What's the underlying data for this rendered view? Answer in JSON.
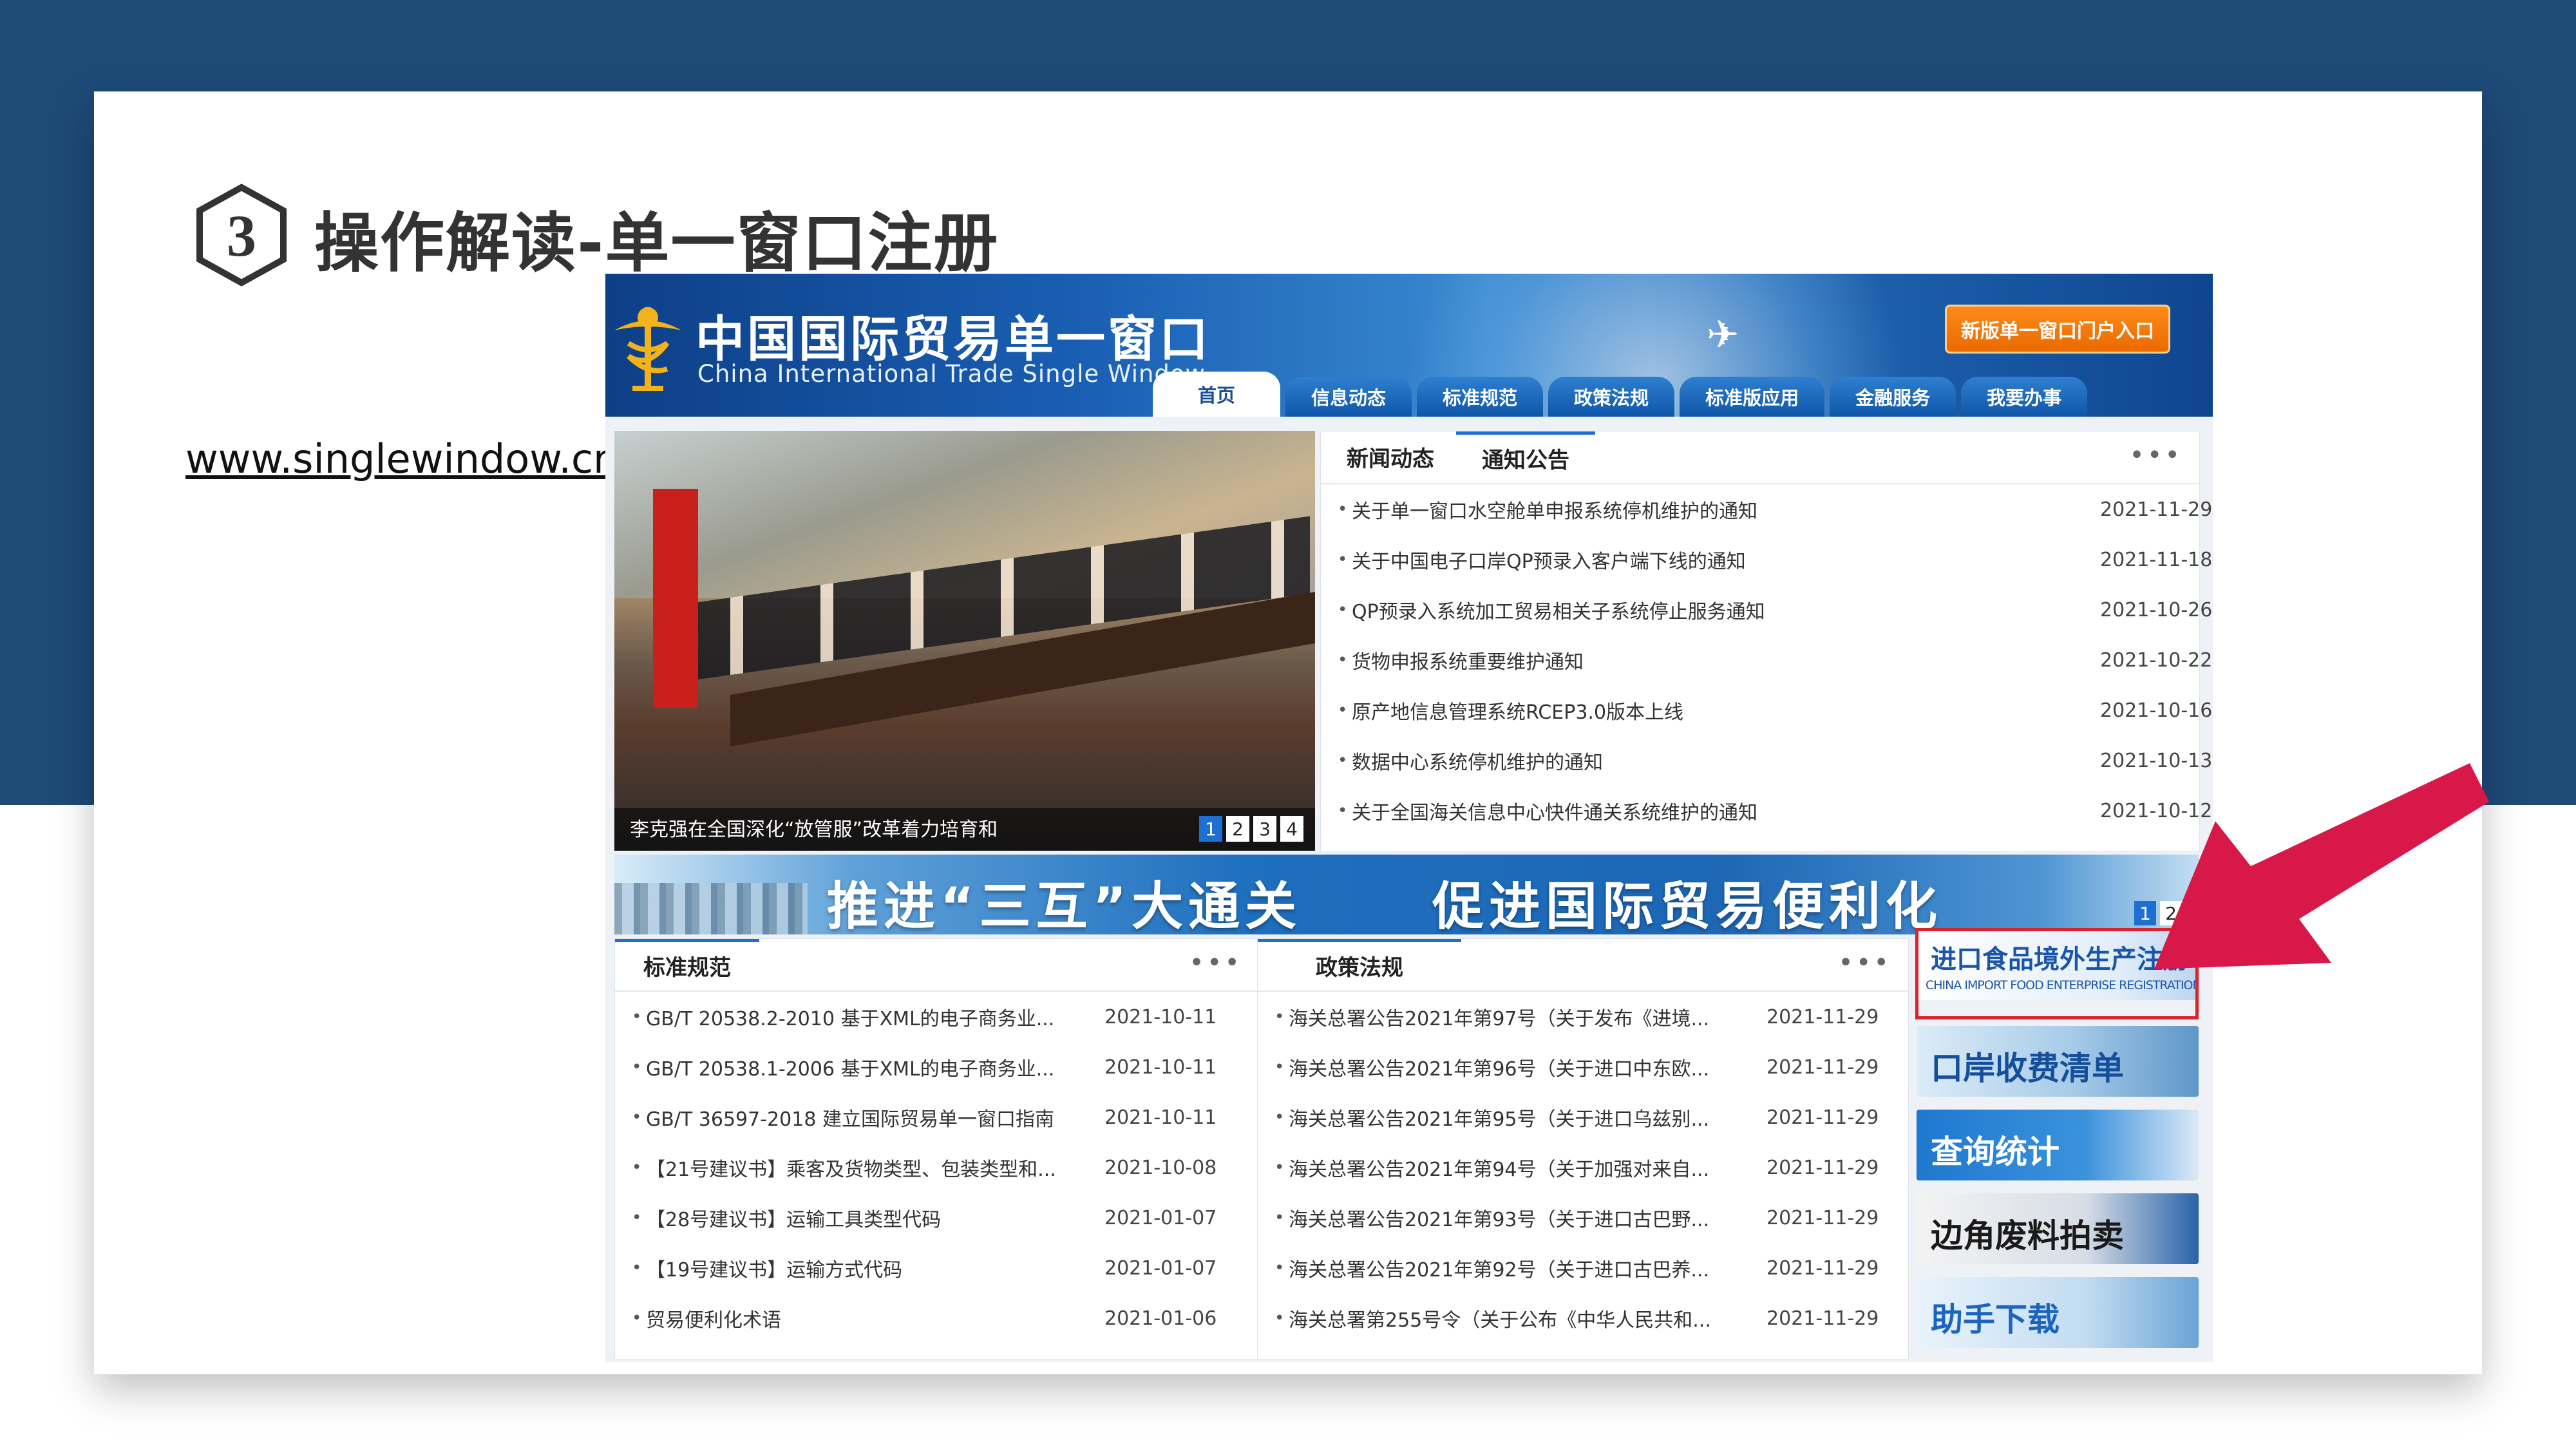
{
  "slide": {
    "number": "3",
    "title": "操作解读-单一窗口注册",
    "url": "www.singlewindow.cn"
  },
  "site": {
    "logo_cn": "中国国际贸易单一窗口",
    "logo_en": "China International Trade Single  Window",
    "portal_button": "新版单一窗口门户入口",
    "nav": [
      "首页",
      "信息动态",
      "标准规范",
      "政策法规",
      "标准版应用",
      "金融服务",
      "我要办事"
    ],
    "active_nav": "首页"
  },
  "carousel": {
    "caption": "李克强在全国深化“放管服”改革着力培育和",
    "pages": [
      "1",
      "2",
      "3",
      "4"
    ],
    "active_page": "1"
  },
  "news": {
    "tabs": [
      "新闻动态",
      "通知公告"
    ],
    "active_tab": "通知公告",
    "more": "•••",
    "items": [
      {
        "title": "关于单一窗口水空舱单申报系统停机维护的通知",
        "date": "2021-11-29"
      },
      {
        "title": "关于中国电子口岸QP预录入客户端下线的通知",
        "date": "2021-11-18"
      },
      {
        "title": "QP预录入系统加工贸易相关子系统停止服务通知",
        "date": "2021-10-26"
      },
      {
        "title": "货物申报系统重要维护通知",
        "date": "2021-10-22"
      },
      {
        "title": "原产地信息管理系统RCEP3.0版本上线",
        "date": "2021-10-16"
      },
      {
        "title": "数据中心系统停机维护的通知",
        "date": "2021-10-13"
      },
      {
        "title": "关于全国海关信息中心快件通关系统维护的通知",
        "date": "2021-10-12"
      }
    ]
  },
  "banner": {
    "left": "推进“三互”大通关",
    "right": "促进国际贸易便利化",
    "pages": [
      "1",
      "2"
    ],
    "active_page": "1"
  },
  "standards": {
    "tab": "标准规范",
    "more": "•••",
    "items": [
      {
        "title": "GB/T 20538.2-2010 基于XML的电子商务业...",
        "date": "2021-10-11"
      },
      {
        "title": "GB/T 20538.1-2006 基于XML的电子商务业...",
        "date": "2021-10-11"
      },
      {
        "title": "GB/T 36597-2018 建立国际贸易单一窗口指南",
        "date": "2021-10-11"
      },
      {
        "title": "【21号建议书】乘客及货物类型、包装类型和...",
        "date": "2021-10-08"
      },
      {
        "title": "【28号建议书】运输工具类型代码",
        "date": "2021-01-07"
      },
      {
        "title": "【19号建议书】运输方式代码",
        "date": "2021-01-07"
      },
      {
        "title": "贸易便利化术语",
        "date": "2021-01-06"
      }
    ]
  },
  "policies": {
    "tab": "政策法规",
    "more": "•••",
    "items": [
      {
        "title": "海关总署公告2021年第97号（关于发布《进境...",
        "date": "2021-11-29"
      },
      {
        "title": "海关总署公告2021年第96号（关于进口中东欧...",
        "date": "2021-11-29"
      },
      {
        "title": "海关总署公告2021年第95号（关于进口乌兹别...",
        "date": "2021-11-29"
      },
      {
        "title": "海关总署公告2021年第94号（关于加强对来自...",
        "date": "2021-11-29"
      },
      {
        "title": "海关总署公告2021年第93号（关于进口古巴野...",
        "date": "2021-11-29"
      },
      {
        "title": "海关总署公告2021年第92号（关于进口古巴养...",
        "date": "2021-11-29"
      },
      {
        "title": "海关总署第255号令（关于公布《中华人民共和...",
        "date": "2021-11-29"
      }
    ]
  },
  "side_links": {
    "food_registration": "进口食品境外生产注册",
    "food_registration_en": "CHINA IMPORT FOOD ENTERPRISE REGISTRATION",
    "port_fees": "口岸收费清单",
    "query_stats": "查询统计",
    "border_auction": "边角废料拍卖",
    "helper_download": "助手下载"
  },
  "colors": {
    "slide_bg": "#1e4a78",
    "site_blue": "#1d6fd2",
    "portal_orange": "#f07a0a",
    "highlight_red": "#d9232e"
  }
}
